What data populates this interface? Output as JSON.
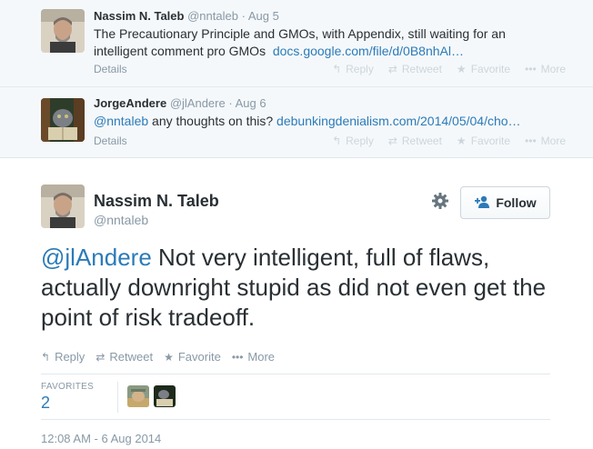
{
  "context_tweets": [
    {
      "name": "Nassim N. Taleb",
      "username": "@nntaleb",
      "date": "Aug 5",
      "text_line1": "The Precautionary Principle and GMOs, with Appendix, still waiting for an",
      "text_line2": "intelligent comment pro GMOs",
      "link": "docs.google.com/file/d/0B8nhAl…",
      "details": "Details",
      "actions": {
        "reply": "Reply",
        "retweet": "Retweet",
        "favorite": "Favorite",
        "more": "More"
      }
    },
    {
      "name": "JorgeAndere",
      "username": "@jlAndere",
      "date": "Aug 6",
      "mention": "@nntaleb",
      "text": "any thoughts on this?",
      "link": "debunkingdenialism.com/2014/05/04/cho…",
      "details": "Details",
      "actions": {
        "reply": "Reply",
        "retweet": "Retweet",
        "favorite": "Favorite",
        "more": "More"
      }
    }
  ],
  "main_tweet": {
    "name": "Nassim N. Taleb",
    "username": "@nntaleb",
    "follow_label": "Follow",
    "mention": "@jlAndere",
    "text": "Not very intelligent, full of flaws, actually downright stupid as did not even get the point of risk tradeoff.",
    "actions": {
      "reply": "Reply",
      "retweet": "Retweet",
      "favorite": "Favorite",
      "more": "More"
    },
    "favorites_label": "FAVORITES",
    "favorites_count": "2",
    "timestamp": "12:08 AM - 6 Aug 2014"
  },
  "icons": {
    "reply": "reply-arrow-icon",
    "retweet": "retweet-icon",
    "favorite": "star-icon",
    "more": "ellipsis-icon",
    "settings": "gear-icon",
    "follow": "add-user-icon"
  },
  "colors": {
    "link": "#2b7bb9",
    "muted": "#8899a6",
    "context_bg": "#f5f8fa",
    "text": "#292f33"
  }
}
